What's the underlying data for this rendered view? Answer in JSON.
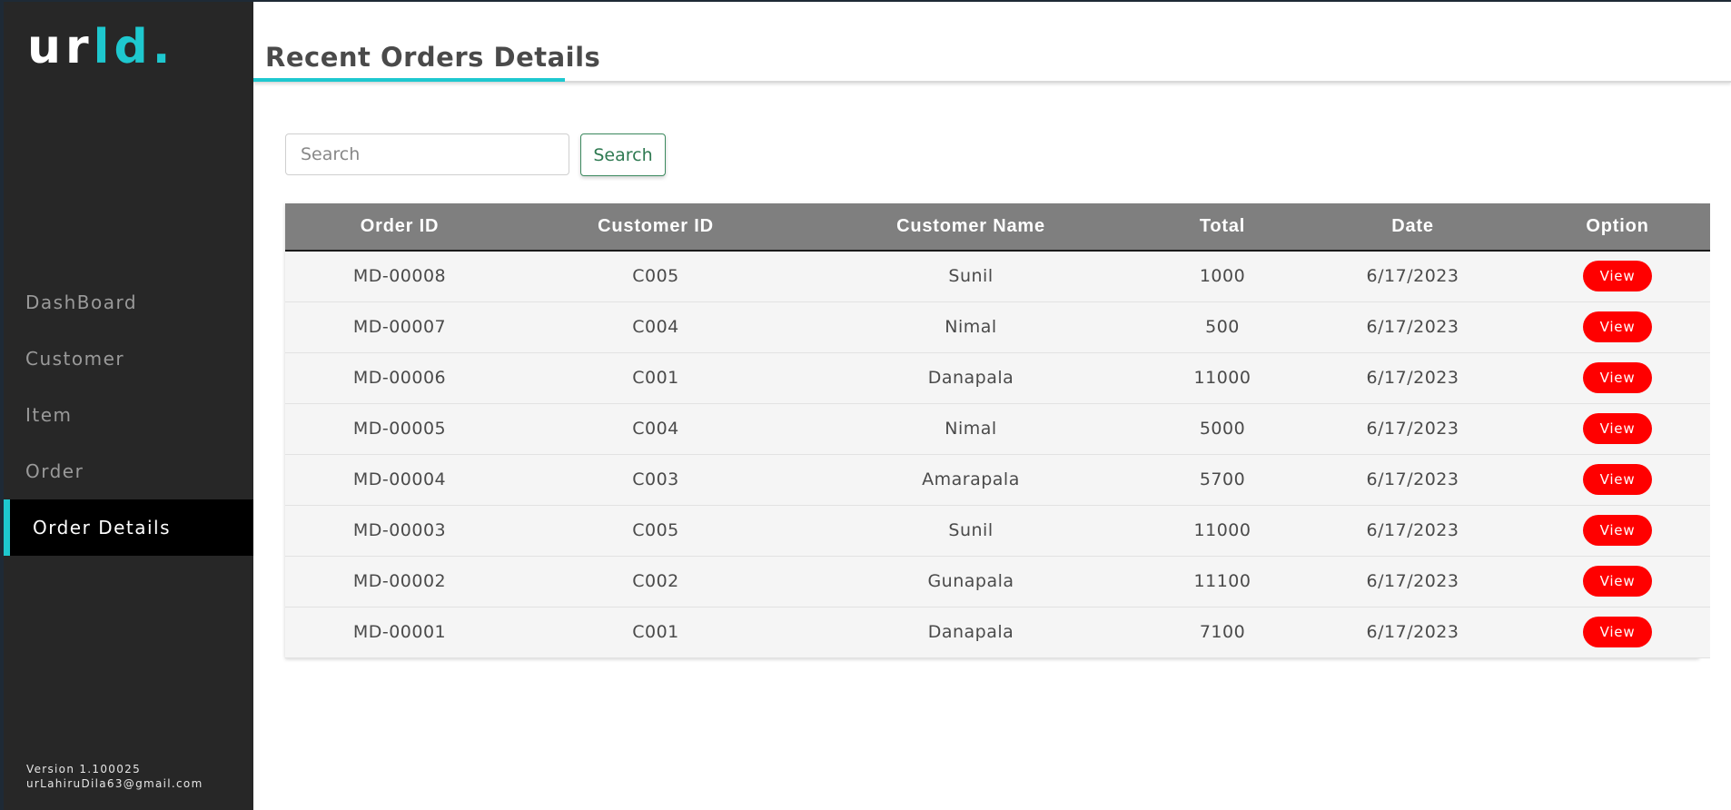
{
  "sidebar": {
    "logo": {
      "part1": "ur",
      "part2": "ld."
    },
    "items": [
      {
        "label": "DashBoard",
        "name": "sidebar-item-dashboard",
        "active": false
      },
      {
        "label": "Customer",
        "name": "sidebar-item-customer",
        "active": false
      },
      {
        "label": "Item",
        "name": "sidebar-item-item",
        "active": false
      },
      {
        "label": "Order",
        "name": "sidebar-item-order",
        "active": false
      },
      {
        "label": "Order Details",
        "name": "sidebar-item-order-details",
        "active": true
      }
    ],
    "version": "Version 1.100025",
    "email": "urLahiruDila63@gmail.com"
  },
  "header": {
    "title": "Recent Orders Details"
  },
  "search": {
    "placeholder": "Search",
    "value": "",
    "button_label": "Search"
  },
  "table": {
    "columns": [
      "Order ID",
      "Customer ID",
      "Customer Name",
      "Total",
      "Date",
      "Option"
    ],
    "rows": [
      {
        "order_id": "MD-00008",
        "customer_id": "C005",
        "customer_name": "Sunil",
        "total": "1000",
        "date": "6/17/2023",
        "option": "View"
      },
      {
        "order_id": "MD-00007",
        "customer_id": "C004",
        "customer_name": "Nimal",
        "total": "500",
        "date": "6/17/2023",
        "option": "View"
      },
      {
        "order_id": "MD-00006",
        "customer_id": "C001",
        "customer_name": "Danapala",
        "total": "11000",
        "date": "6/17/2023",
        "option": "View"
      },
      {
        "order_id": "MD-00005",
        "customer_id": "C004",
        "customer_name": "Nimal",
        "total": "5000",
        "date": "6/17/2023",
        "option": "View"
      },
      {
        "order_id": "MD-00004",
        "customer_id": "C003",
        "customer_name": "Amarapala",
        "total": "5700",
        "date": "6/17/2023",
        "option": "View"
      },
      {
        "order_id": "MD-00003",
        "customer_id": "C005",
        "customer_name": "Sunil",
        "total": "11000",
        "date": "6/17/2023",
        "option": "View"
      },
      {
        "order_id": "MD-00002",
        "customer_id": "C002",
        "customer_name": "Gunapala",
        "total": "11100",
        "date": "6/17/2023",
        "option": "View"
      },
      {
        "order_id": "MD-00001",
        "customer_id": "C001",
        "customer_name": "Danapala",
        "total": "7100",
        "date": "6/17/2023",
        "option": "View"
      }
    ]
  },
  "colors": {
    "accent": "#1ec8cf",
    "sidebar_bg": "#272727",
    "table_header_bg": "#7f7f7f",
    "view_button": "#ff0000",
    "search_button_border": "#3c8a5f"
  }
}
